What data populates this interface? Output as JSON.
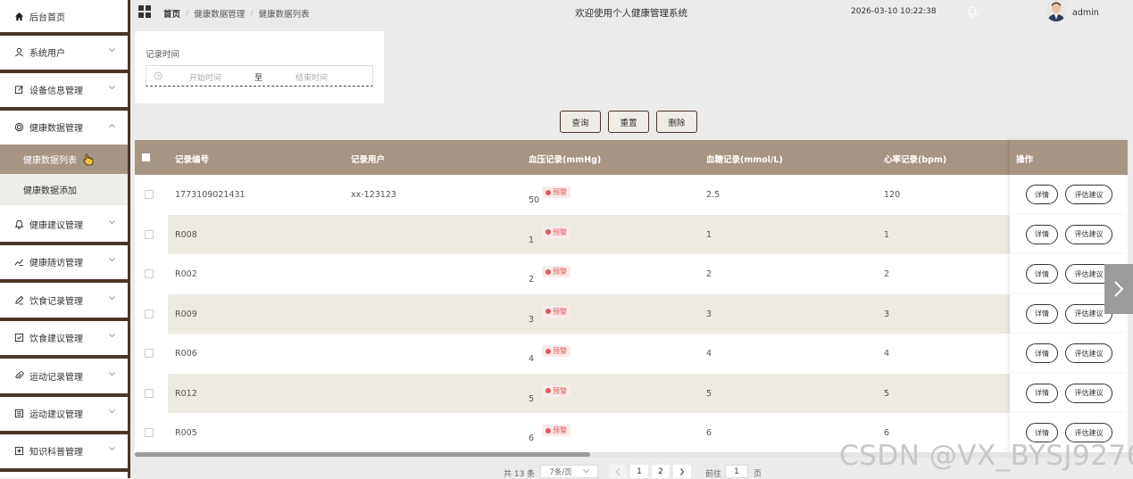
{
  "sidebar": {
    "home": "后台首页",
    "items": [
      {
        "label": "系统用户",
        "icon": "user-icon"
      },
      {
        "label": "设备信息管理",
        "icon": "edit-icon"
      },
      {
        "label": "健康数据管理",
        "icon": "heart-icon"
      },
      {
        "label": "健康建议管理",
        "icon": "bell-icon"
      },
      {
        "label": "健康随访管理",
        "icon": "chart-icon"
      },
      {
        "label": "饮食记录管理",
        "icon": "pen-icon"
      },
      {
        "label": "饮食建议管理",
        "icon": "check-doc-icon"
      },
      {
        "label": "运动记录管理",
        "icon": "clip-icon"
      },
      {
        "label": "运动建议管理",
        "icon": "list-doc-icon"
      },
      {
        "label": "知识科普管理",
        "icon": "plus-doc-icon"
      }
    ],
    "submenu": [
      "健康数据列表",
      "健康数据添加"
    ]
  },
  "header": {
    "breadcrumb": [
      "首页",
      "健康数据管理",
      "健康数据列表"
    ],
    "welcome": "欢迎使用个人健康管理系统",
    "datetime": "2026-03-10 10:22:38",
    "username": "admin"
  },
  "search": {
    "label": "记录时间",
    "start_placeholder": "开始时间",
    "separator": "至",
    "end_placeholder": "结束时间"
  },
  "actions": {
    "query": "查询",
    "reset": "重置",
    "delete": "删除"
  },
  "table": {
    "columns": [
      "记录编号",
      "记录用户",
      "血压记录(mmHg)",
      "血糖记录(mmol/L)",
      "心率记录(bpm)",
      "操作"
    ],
    "warn_label": "预警",
    "detail_label": "详情",
    "advice_label": "评估建议",
    "rows": [
      {
        "id": "1773109021431",
        "user": "xx-123123",
        "bp": "50",
        "glucose": "2.5",
        "hr": "120"
      },
      {
        "id": "R008",
        "user": "",
        "bp": "1",
        "glucose": "1",
        "hr": "1"
      },
      {
        "id": "R002",
        "user": "",
        "bp": "2",
        "glucose": "2",
        "hr": "2"
      },
      {
        "id": "R009",
        "user": "",
        "bp": "3",
        "glucose": "3",
        "hr": "3"
      },
      {
        "id": "R006",
        "user": "",
        "bp": "4",
        "glucose": "4",
        "hr": "4"
      },
      {
        "id": "R012",
        "user": "",
        "bp": "5",
        "glucose": "5",
        "hr": "5"
      },
      {
        "id": "R005",
        "user": "",
        "bp": "6",
        "glucose": "6",
        "hr": "6"
      }
    ]
  },
  "pagination": {
    "total": "共 13 条",
    "page_size": "7条/页",
    "pages": [
      "1",
      "2"
    ],
    "goto_label": "前往",
    "goto_value": "1",
    "page_unit": "页"
  },
  "watermark": "CSDN @VX_BYSJ9276"
}
